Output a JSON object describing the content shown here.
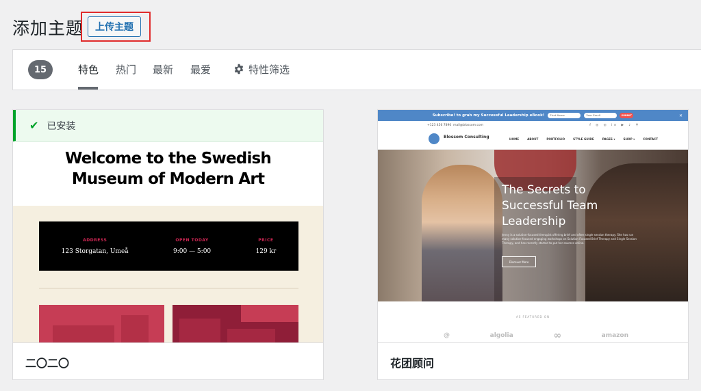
{
  "header": {
    "title": "添加主题",
    "upload_label": "上传主题"
  },
  "filter": {
    "count": "15",
    "tabs": [
      {
        "label": "特色",
        "active": true
      },
      {
        "label": "热门",
        "active": false
      },
      {
        "label": "最新",
        "active": false
      },
      {
        "label": "最爱",
        "active": false
      }
    ],
    "feature_filter_label": "特性筛选",
    "feature_filter_icon": "gear-icon"
  },
  "themes": [
    {
      "name": "二〇二〇",
      "installed_label": "已安装",
      "preview": {
        "heading": "Welcome to the Swedish Museum of Modern Art",
        "info": [
          {
            "label": "ADDRESS",
            "value": "123 Storgatan, Umeå"
          },
          {
            "label": "OPEN TODAY",
            "value": "9:00 — 5:00"
          },
          {
            "label": "PRICE",
            "value": "129 kr"
          }
        ]
      }
    },
    {
      "name": "花团顾问",
      "preview": {
        "topbar_text": "Subscribe! to grab my Successful Leadership eBook!",
        "topbar_input1": "First Name",
        "topbar_input2": "Your Email",
        "topbar_submit": "SUBMIT",
        "contact_phone": "+123 456 7890",
        "contact_email": "mail@blossom.com",
        "social_icons": "f ◎ ◎ in ▶ ♪  ⚲",
        "brand": "Blossom Consulting",
        "menu": [
          "HOME",
          "ABOUT",
          "PORTFOLIO",
          "STYLE GUIDE",
          "PAGES ▾",
          "SHOP ▾",
          "CONTACT"
        ],
        "hero_title": "The Secrets to Successful Team Leadership",
        "hero_text": "Jenny is a solution-focused therapist offering brief and often single session therapy. She has run many solution-focused engaging workshops on Solution Focused Brief Therapy and Single Session Therapy, and has recently started to put her courses online.",
        "hero_button": "Discover More",
        "featured_title": "AS FEATURED ON",
        "featured_logos": [
          "@",
          "algolia",
          "∞",
          "amazon"
        ]
      }
    }
  ]
}
